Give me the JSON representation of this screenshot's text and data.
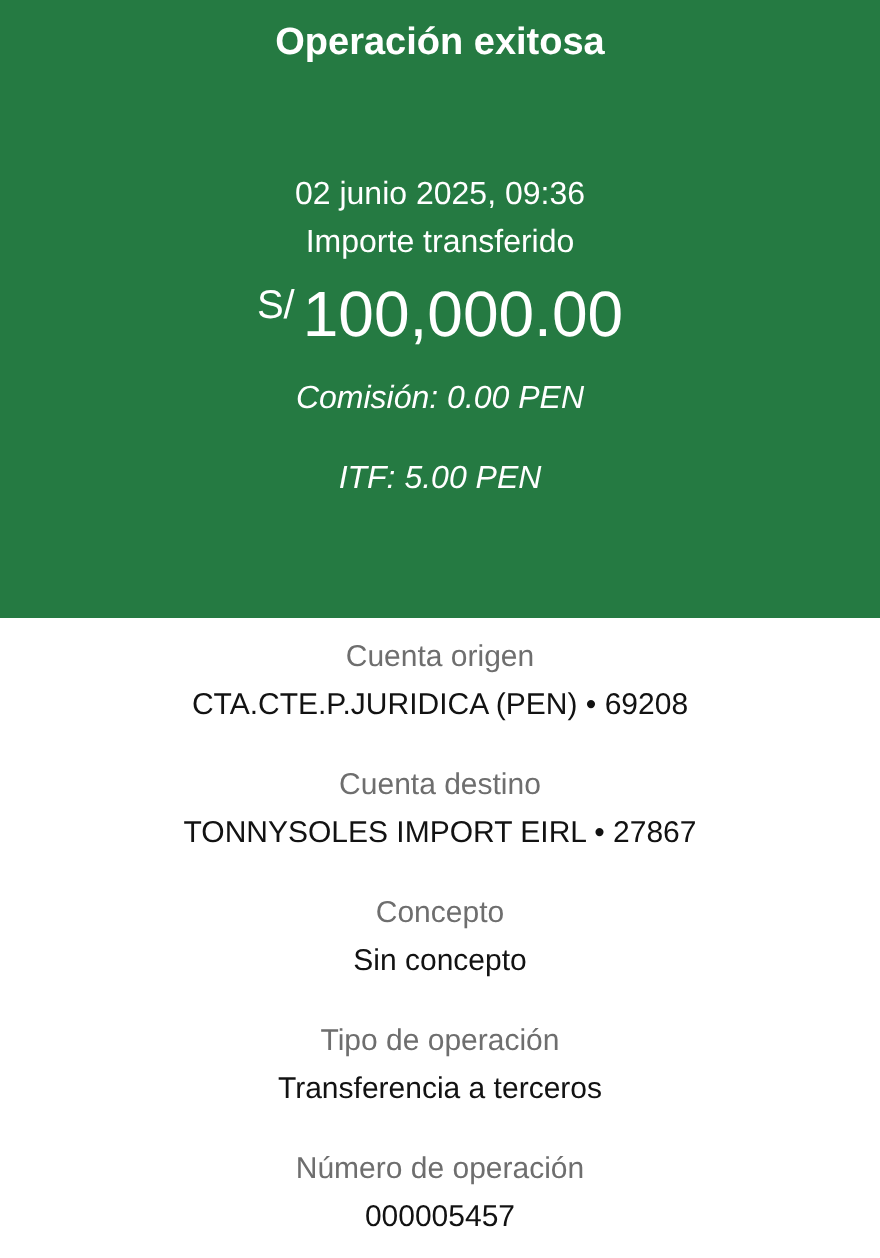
{
  "header": {
    "title": "Operación exitosa",
    "datetime": "02 junio 2025, 09:36",
    "amount_label": "Importe transferido",
    "currency": "S/",
    "amount": "100,000.00",
    "commission": "Comisión: 0.00 PEN",
    "itf": "ITF: 5.00 PEN"
  },
  "details": [
    {
      "label": "Cuenta origen",
      "value": "CTA.CTE.P.JURIDICA (PEN) • 69208"
    },
    {
      "label": "Cuenta destino",
      "value": "TONNYSOLES IMPORT EIRL • 27867"
    },
    {
      "label": "Concepto",
      "value": "Sin concepto"
    },
    {
      "label": "Tipo de operación",
      "value": "Transferencia a terceros"
    },
    {
      "label": "Número de operación",
      "value": "000005457"
    }
  ]
}
